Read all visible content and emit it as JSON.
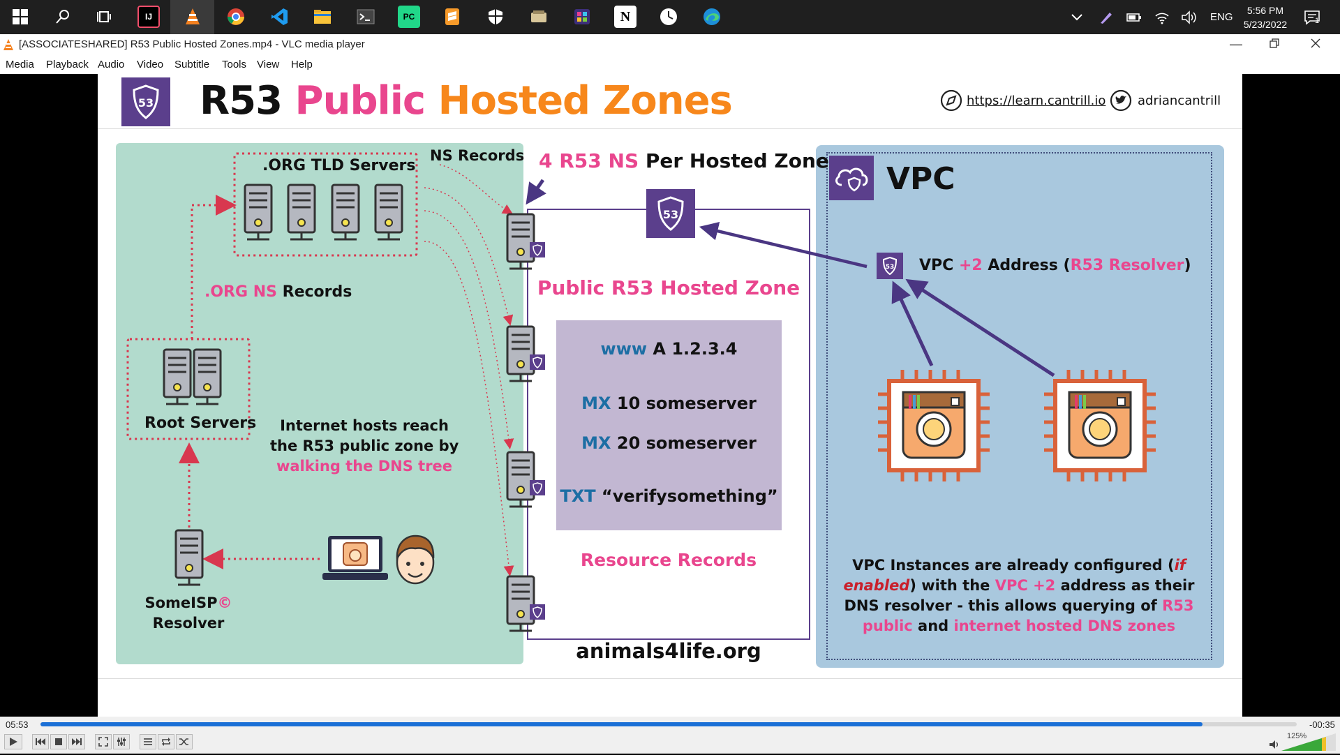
{
  "taskbar": {
    "tray": {
      "language": "ENG",
      "time": "5:56 PM",
      "date": "5/23/2022",
      "notifications_count": "1"
    },
    "apps": [
      {
        "icon": "windows-start-icon"
      },
      {
        "icon": "search-icon"
      },
      {
        "icon": "task-view-icon"
      },
      {
        "icon": "intellij-icon",
        "label": "IJ"
      },
      {
        "icon": "vlc-icon"
      },
      {
        "icon": "chrome-icon"
      },
      {
        "icon": "vscode-icon"
      },
      {
        "icon": "file-explorer-icon"
      },
      {
        "icon": "terminal-icon"
      },
      {
        "icon": "pycharm-icon",
        "label": "PC"
      },
      {
        "icon": "sublime-text-icon"
      },
      {
        "icon": "shield-app-icon"
      },
      {
        "icon": "app-icon"
      },
      {
        "icon": "app-icon-2"
      },
      {
        "icon": "notion-icon",
        "label": "N"
      },
      {
        "icon": "clock-app-icon"
      },
      {
        "icon": "edge-icon"
      }
    ]
  },
  "window": {
    "title": "[ASSOCIATESHARED] R53 Public Hosted Zones.mp4 - VLC media player"
  },
  "menu": [
    "Media",
    "Playback",
    "Audio",
    "Video",
    "Subtitle",
    "Tools",
    "View",
    "Help"
  ],
  "slide": {
    "title_part1": "R53 ",
    "title_part2": "Public ",
    "title_part3": "Hosted Zones",
    "badge": "53",
    "link": "https://learn.cantrill.io",
    "handle": "adriancantrill",
    "tld_label": ".ORG TLD Servers",
    "ns_records_label": "NS Records",
    "org_ns_part1": ".ORG NS",
    "org_ns_part2": " Records",
    "root_label": "Root Servers",
    "internet_hosts_line1": "Internet hosts reach",
    "internet_hosts_line2": "the R53 public zone by",
    "internet_hosts_line3": "walking the DNS tree",
    "isp_line1": "SomeISP",
    "isp_mark": "©",
    "isp_line2": "Resolver",
    "per_zone_part1": "4 R53 NS",
    "per_zone_part2": " Per Hosted Zone",
    "public_zone": "Public R53 Hosted Zone",
    "records": [
      {
        "type": "www",
        "value": " A 1.2.3.4"
      },
      {
        "type": "MX",
        "value": " 10 someserver"
      },
      {
        "type": "MX",
        "value": " 20 someserver"
      },
      {
        "type": "TXT",
        "value": " “verifysomething”"
      }
    ],
    "resource_records": "Resource Records",
    "domain": "animals4life.org",
    "vpc": "VPC",
    "vpc_resolver_part1": "VPC ",
    "vpc_resolver_part2": "+2",
    "vpc_resolver_part3": " Address (",
    "vpc_resolver_part4": "R53 Resolver",
    "vpc_resolver_part5": ")",
    "vpc_note": {
      "l1a": "VPC Instances are already configured (",
      "l1b": "if",
      "l2a": "enabled",
      "l2b": ") with the ",
      "l2c": "VPC +2",
      "l2d": " address as their",
      "l3a": "DNS resolver - this allows querying of ",
      "l3b": "R53",
      "l4a": "public",
      "l4b": " and ",
      "l4c": "internet hosted DNS zones"
    }
  },
  "player": {
    "elapsed": "05:53",
    "remaining": "-00:35",
    "progress": 0.925,
    "volume": "125%"
  },
  "colors": {
    "accent": "#1a6fd6",
    "pink": "#e9468e",
    "orange": "#f7871b",
    "purple": "#5b3f8c",
    "green_panel": "#b2dbcd",
    "blue_panel": "#a9c8de"
  }
}
